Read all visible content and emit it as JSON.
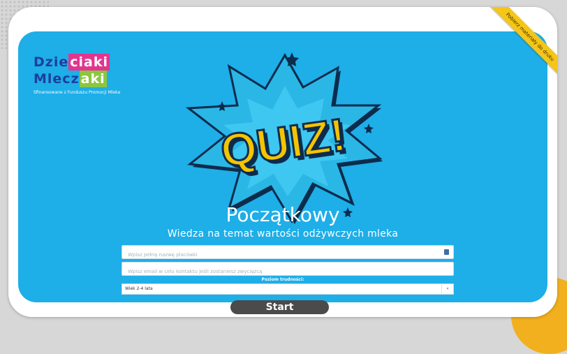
{
  "ribbon": {
    "label": "Pobierz materiały do druku"
  },
  "logo": {
    "line1_a": "Dzie",
    "line1_b": "ciaki",
    "line2_a": "Mlecz",
    "line2_b": "aki",
    "subtitle": "Sfinansowane z Funduszu Promocji Mleka"
  },
  "quiz": {
    "badge_text": "QUIZ!",
    "level_title": "Początkowy",
    "subtitle": "Wiedza na temat wartości odżywczych mleka"
  },
  "form": {
    "institution_placeholder": "Wpisz pełną nazwę placówki",
    "email_placeholder": "Wpisz email w celu kontaktu jeśli zostaniesz zwycięzcą",
    "level_label": "Poziom trudności:",
    "level_selected": "Wiek 2-4 lata"
  },
  "actions": {
    "start_label": "Start"
  },
  "colors": {
    "panel_blue": "#1eaee8",
    "quiz_yellow": "#f5c400",
    "start_button": "#4b4b4b",
    "ribbon_yellow": "#f5c518"
  }
}
